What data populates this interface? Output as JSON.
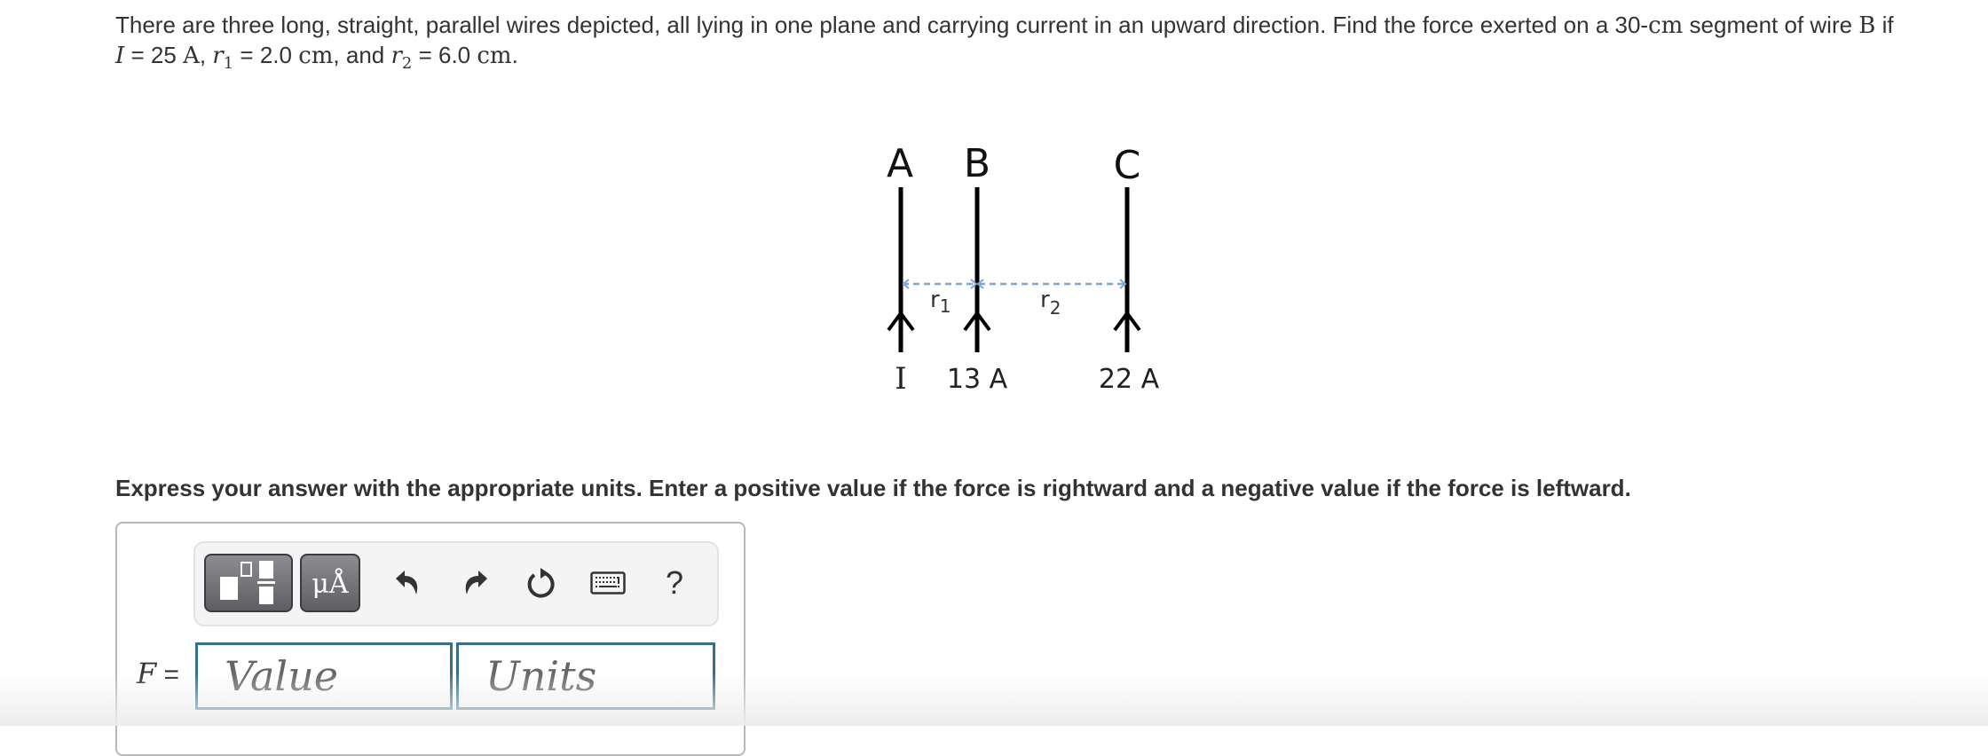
{
  "problem": {
    "line1_text": "There are three long, straight, parallel wires depicted, all lying in one plane and carrying current in an upward direction. Find the force exerted on a 30-",
    "line1_unit": "cm",
    "line1_mid": " segment of wire ",
    "line1_wire": "B",
    "line1_end": " if",
    "line2": {
      "I_symbol": "I",
      "I_eq": " = 25 ",
      "I_unit": "A",
      "sep1": ", ",
      "r1_symbol": "r",
      "r1_sub": "1",
      "r1_eq": " = 2.0 ",
      "r1_unit": "cm",
      "sep2": ", and ",
      "r2_symbol": "r",
      "r2_sub": "2",
      "r2_eq": " = 6.0 ",
      "r2_unit": "cm",
      "end": "."
    }
  },
  "diagram": {
    "wires": [
      {
        "name": "A",
        "current_label": "I"
      },
      {
        "name": "B",
        "current_label": "13 A"
      },
      {
        "name": "C",
        "current_label": "22 A"
      }
    ],
    "r1_label": "r",
    "r1_sub": "1",
    "r2_label": "r",
    "r2_sub": "2",
    "current_direction": "upward",
    "dash_color": "#7fa6d6"
  },
  "instruction": "Express your answer with the appropriate units. Enter a positive value if the force is rightward and a negative value if the force is leftward.",
  "answer": {
    "label_symbol": "F",
    "label_eq": " =",
    "value_placeholder": "Value",
    "units_placeholder": "Units",
    "value": "",
    "units": "",
    "input_border_color": "#34718f"
  },
  "toolbar": {
    "template_button": "templates-icon",
    "units_button_label": "μÅ",
    "undo": "undo-icon",
    "redo": "redo-icon",
    "reset": "reset-icon",
    "keyboard": "keyboard-icon",
    "help_label": "?"
  }
}
